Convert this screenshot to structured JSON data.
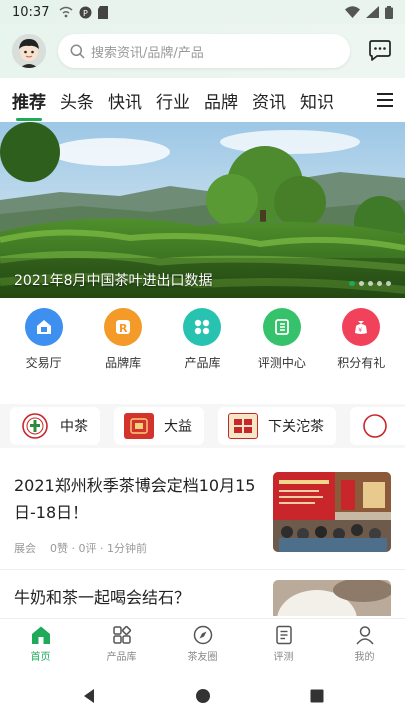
{
  "status_bar": {
    "time": "10:37"
  },
  "header": {
    "search_placeholder": "搜索资讯/品牌/产品"
  },
  "tabs": [
    {
      "label": "推荐",
      "active": true
    },
    {
      "label": "头条"
    },
    {
      "label": "快讯"
    },
    {
      "label": "行业"
    },
    {
      "label": "品牌"
    },
    {
      "label": "资讯"
    },
    {
      "label": "知识"
    }
  ],
  "banner": {
    "caption": "2021年8月中国茶叶进出口数据",
    "slide_index": 1,
    "slide_count": 5
  },
  "quick_nav": [
    {
      "label": "交易厅",
      "icon": "house-icon",
      "color": "#3d8ff0"
    },
    {
      "label": "品牌库",
      "icon": "brand-r-icon",
      "color": "#f39a29"
    },
    {
      "label": "产品库",
      "icon": "grid-icon",
      "color": "#27c2b0"
    },
    {
      "label": "评测中心",
      "icon": "document-icon",
      "color": "#36c26a"
    },
    {
      "label": "积分有礼",
      "icon": "gift-bag-icon",
      "color": "#f2415b"
    }
  ],
  "brands": [
    {
      "name": "中茶"
    },
    {
      "name": "大益"
    },
    {
      "name": "下关沱茶"
    }
  ],
  "articles": [
    {
      "title": "2021郑州秋季茶博会定档10月15日-18日！",
      "category": "展会",
      "likes": "0赞",
      "comments": "0评",
      "time": "1分钟前"
    },
    {
      "title": "牛奶和茶一起喝会结石？"
    }
  ],
  "bottom_nav": [
    {
      "label": "首页",
      "icon": "home-icon",
      "active": true
    },
    {
      "label": "产品库",
      "icon": "products-grid-icon"
    },
    {
      "label": "茶友圈",
      "icon": "compass-icon"
    },
    {
      "label": "评测",
      "icon": "review-doc-icon"
    },
    {
      "label": "我的",
      "icon": "profile-icon"
    }
  ],
  "colors": {
    "accent": "#1faa59"
  }
}
